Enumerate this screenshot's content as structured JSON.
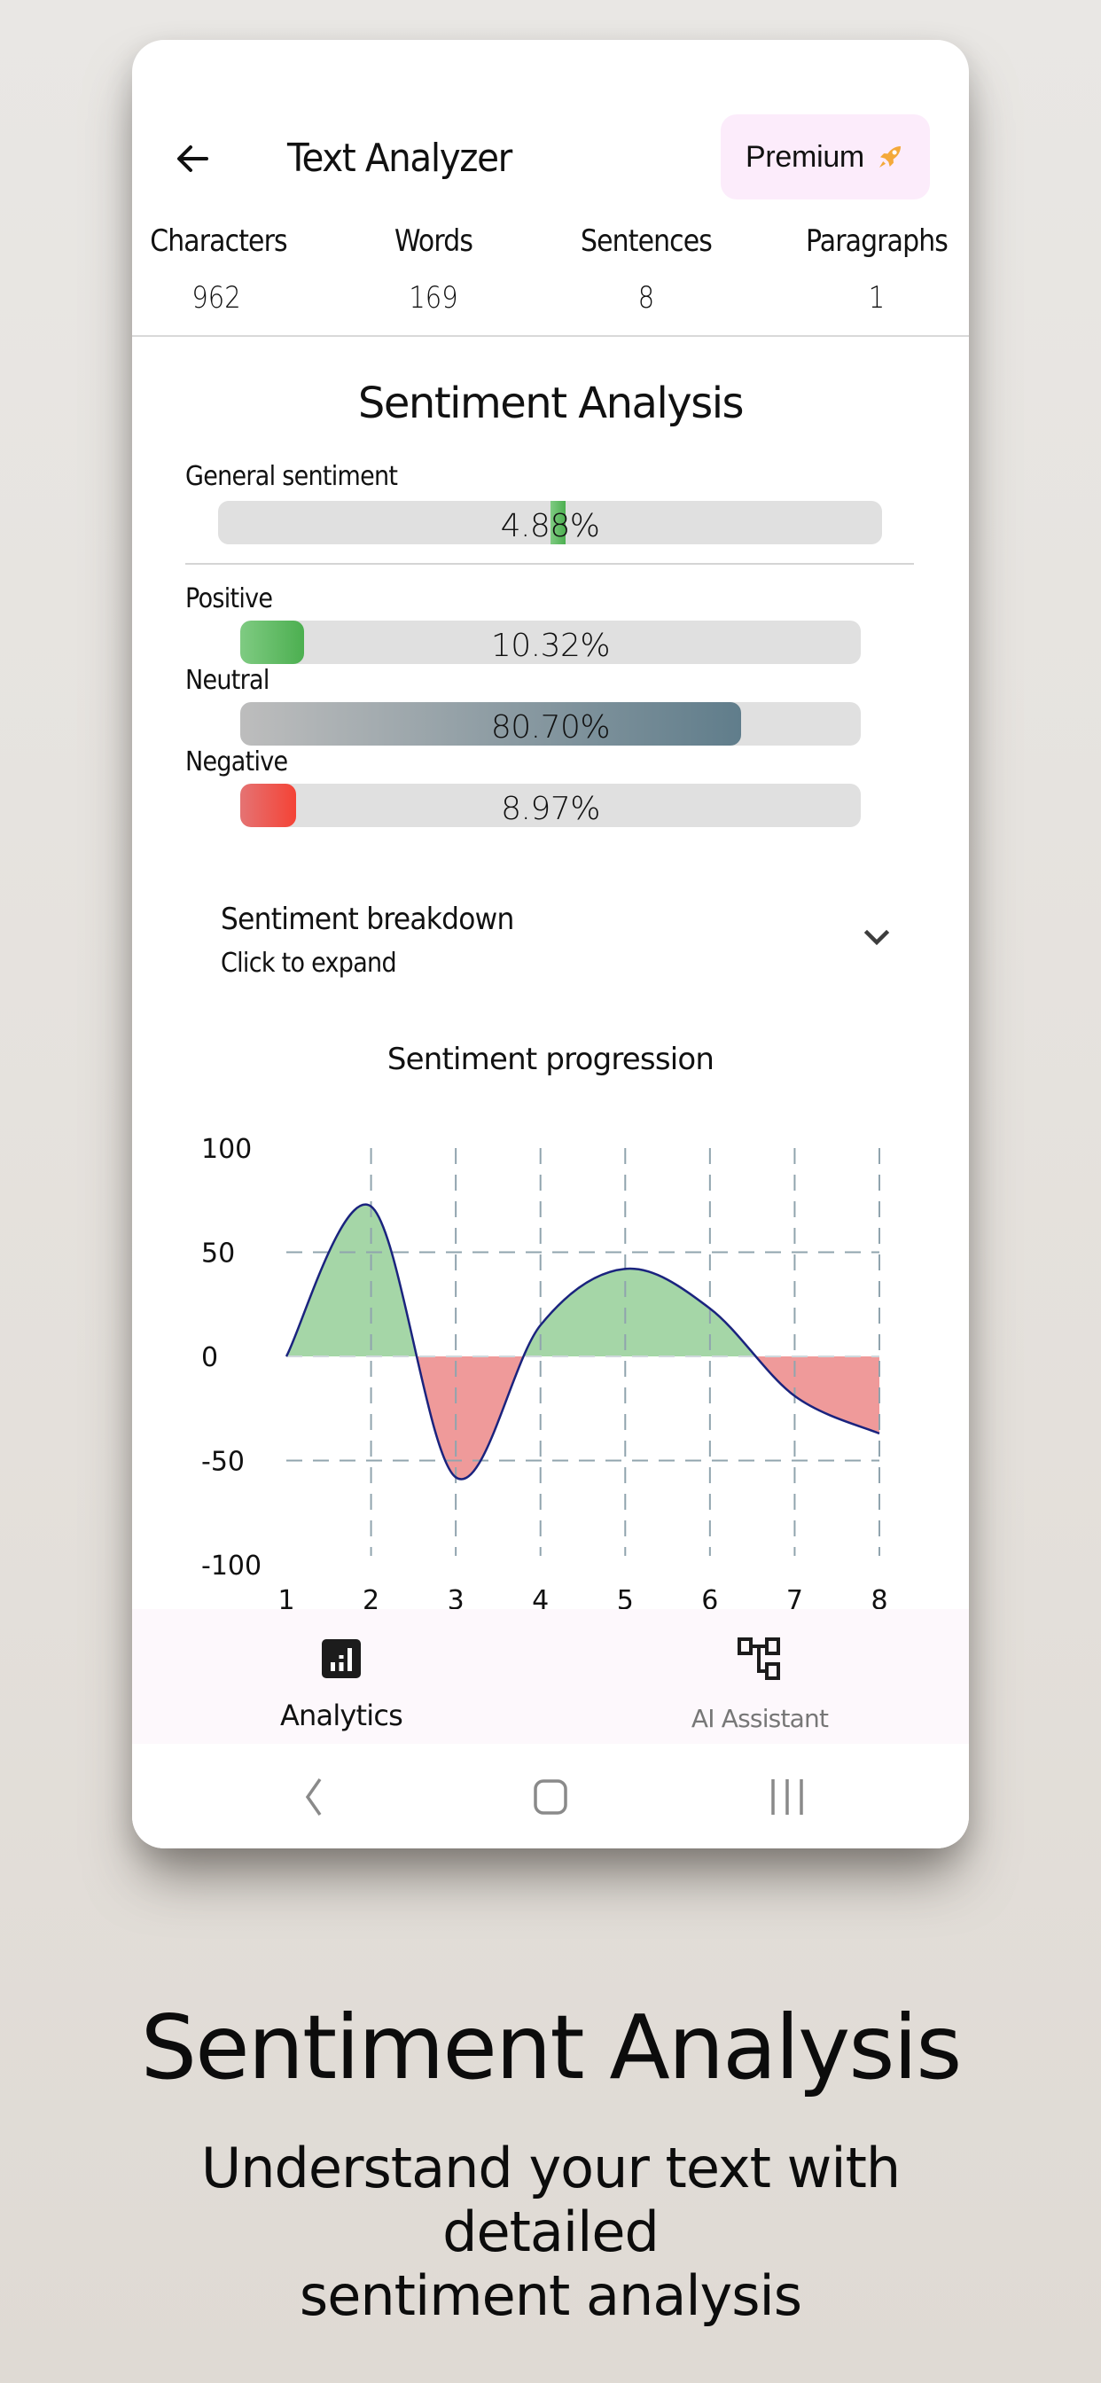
{
  "header": {
    "title": "Text Analyzer",
    "back_icon": "arrow-left-icon",
    "premium_label": "Premium",
    "premium_icon": "rocket-icon",
    "premium_bg": "#fcecfb",
    "premium_icon_color": "#f4a93a"
  },
  "stats": [
    {
      "label": "Characters",
      "value": "962"
    },
    {
      "label": "Words",
      "value": "169"
    },
    {
      "label": "Sentences",
      "value": "8"
    },
    {
      "label": "Paragraphs",
      "value": "1"
    }
  ],
  "sentiment": {
    "title": "Sentiment Analysis",
    "general": {
      "label": "General sentiment",
      "value_text": "4.88%",
      "value": 4.88
    },
    "bars": [
      {
        "label": "Positive",
        "value_text": "10.32%",
        "value": 10.32,
        "color_from": "#7fcb82",
        "color_to": "#4caf50"
      },
      {
        "label": "Neutral",
        "value_text": "80.70%",
        "value": 80.7,
        "color_from": "#bdbdbd",
        "color_to": "#607d8b"
      },
      {
        "label": "Negative",
        "value_text": "8.97%",
        "value": 8.97,
        "color_from": "#e57373",
        "color_to": "#f44336"
      }
    ]
  },
  "breakdown": {
    "title": "Sentiment breakdown",
    "subtitle": "Click to expand",
    "icon": "chevron-down-icon"
  },
  "chart_data": {
    "type": "area",
    "title": "Sentiment progression",
    "x": [
      1,
      2,
      3,
      4,
      5,
      6,
      7,
      8
    ],
    "series": [
      {
        "name": "Sentiment",
        "values": [
          0,
          72,
          -58,
          15,
          42,
          23,
          -19,
          -37
        ]
      }
    ],
    "xlabel": "",
    "ylabel": "",
    "ylim": [
      -100,
      100
    ],
    "xlim": [
      1,
      8
    ],
    "yticks": [
      100,
      50,
      0,
      -50,
      -100
    ],
    "xticks": [
      1,
      2,
      3,
      4,
      5,
      6,
      7,
      8
    ],
    "grid": true,
    "positive_color": "#a5d6a7",
    "negative_color": "#ef9a9a",
    "line_color": "#1a237e"
  },
  "bottom_nav": [
    {
      "label": "Analytics",
      "icon": "analytics-icon",
      "active": true
    },
    {
      "label": "AI Assistant",
      "icon": "hierarchy-icon",
      "active": false
    }
  ],
  "system_nav": [
    "back",
    "home",
    "recents"
  ],
  "promo": {
    "title": "Sentiment Analysis",
    "subtitle_line1": "Understand your text with detailed",
    "subtitle_line2": "sentiment analysis"
  }
}
